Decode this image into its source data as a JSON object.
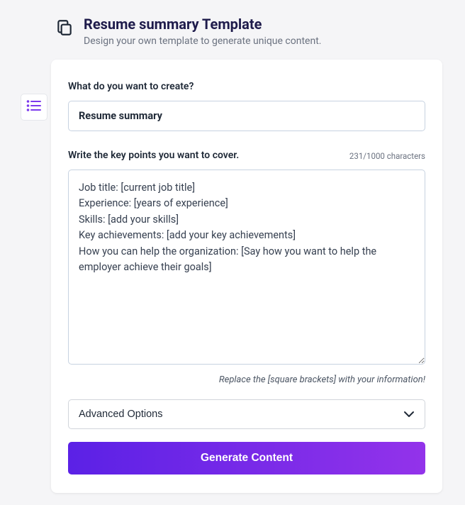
{
  "header": {
    "title": "Resume summary Template",
    "subtitle": "Design your own template to generate unique content."
  },
  "form": {
    "createLabel": "What do you want to create?",
    "createValue": "Resume summary",
    "keyPointsLabel": "Write the key points you want to cover.",
    "charCount": "231/1000 characters",
    "keyPointsValue": "Job title: [current job title]\nExperience: [years of experience]\nSkills: [add your skills]\nKey achievements: [add your key achievements]\nHow you can help the organization: [Say how you want to help the employer achieve their goals]",
    "hint": "Replace the [square brackets] with your information!",
    "advancedLabel": "Advanced Options",
    "generateLabel": "Generate Content"
  }
}
